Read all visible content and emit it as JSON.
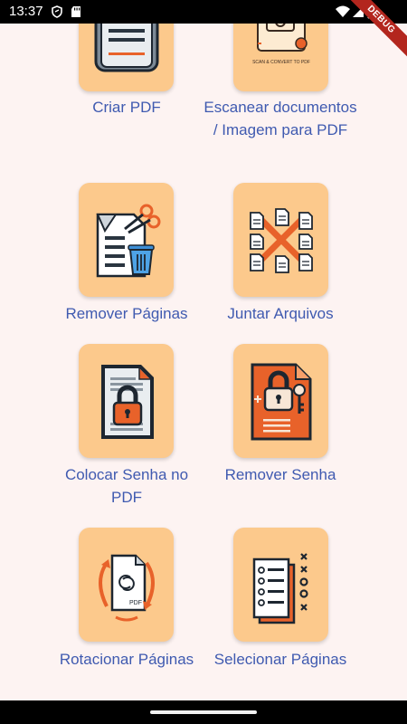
{
  "status_bar": {
    "time": "13:37",
    "icons": [
      "shield-icon",
      "sd-card-icon",
      "wifi-icon",
      "signal-icon",
      "battery-icon"
    ],
    "debug_banner": "DEBUG"
  },
  "colors": {
    "background": "#fdf3f2",
    "tile": "#fcc98c",
    "label": "#3f5ab0",
    "accent": "#e8622a"
  },
  "tiles": [
    {
      "label": "Criar PDF",
      "icon": "create-pdf-icon"
    },
    {
      "label": "Escanear documentos / Imagem para PDF",
      "icon": "scan-document-icon"
    },
    {
      "label": "Remover Páginas",
      "icon": "remove-pages-icon"
    },
    {
      "label": "Juntar Arquivos",
      "icon": "merge-files-icon"
    },
    {
      "label": "Colocar Senha no PDF",
      "icon": "lock-pdf-icon"
    },
    {
      "label": "Remover Senha",
      "icon": "unlock-pdf-icon"
    },
    {
      "label": "Rotacionar Páginas",
      "icon": "rotate-pages-icon"
    },
    {
      "label": "Selecionar Páginas",
      "icon": "select-pages-icon"
    }
  ],
  "scan_icon_caption": "SCAN & CONVERT TO PDF",
  "rotate_icon_caption": "PDF"
}
